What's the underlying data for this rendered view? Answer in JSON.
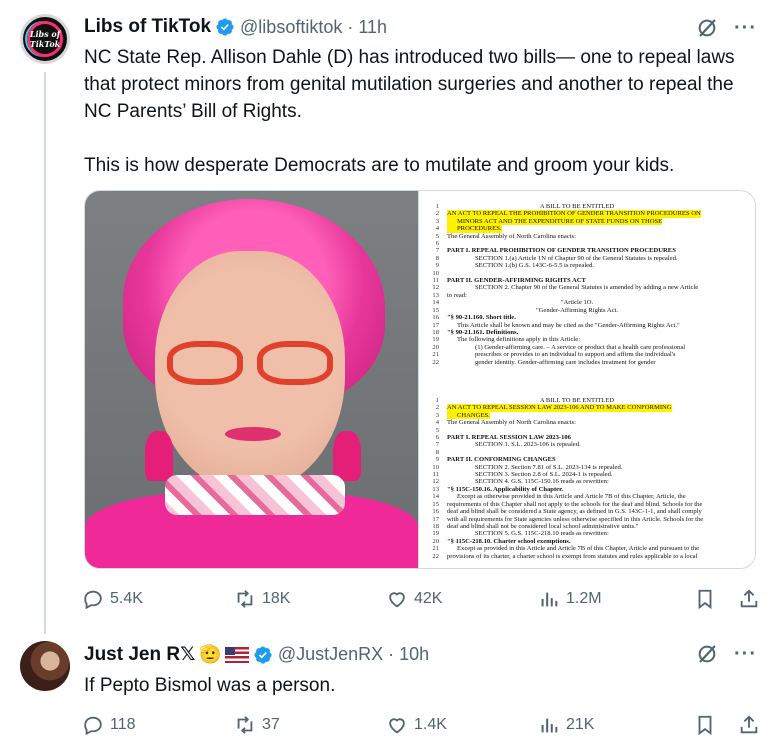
{
  "tweets": [
    {
      "avatar_text": "Libs of TikTok",
      "display_name": "Libs of TikTok",
      "handle": "@libsoftiktok",
      "separator": "·",
      "time": "11h",
      "paragraphs": [
        "NC State Rep. Allison Dahle (D) has introduced two bills— one to repeal laws that protect minors from genital mutilation surgeries and another to repeal the NC Parents’ Bill of Rights.",
        "This is how desperate Democrats are to mutilate and groom your kids."
      ],
      "stats": {
        "replies": "5.4K",
        "reposts": "18K",
        "likes": "42K",
        "views": "1.2M"
      }
    },
    {
      "display_name": "Just Jen R𝕏",
      "handle": "@JustJenRX",
      "separator": "·",
      "time": "10h",
      "emoji": "🫡",
      "text": "If Pepto Bismol was a person.",
      "stats": {
        "replies": "118",
        "reposts": "37",
        "likes": "1.4K",
        "views": "21K"
      }
    }
  ],
  "document": {
    "bill1": [
      {
        "n": "1",
        "t": "A BILL TO BE ENTITLED",
        "style": "center"
      },
      {
        "n": "2",
        "t": "AN ACT TO REPEAL THE PROHIBITION OF GENDER TRANSITION PROCEDURES ON",
        "style": "hl"
      },
      {
        "n": "3",
        "t": "MINORS ACT AND THE EXPENDITURE OF STATE FUNDS ON THOSE",
        "style": "hl indent1"
      },
      {
        "n": "4",
        "t": "PROCEDURES.",
        "style": "hl indent1"
      },
      {
        "n": "5",
        "t": "The General Assembly of North Carolina enacts:",
        "style": ""
      },
      {
        "n": "6",
        "t": "",
        "style": ""
      },
      {
        "n": "7",
        "t": "PART I. REPEAL PROHIBITION OF GENDER TRANSITION PROCEDURES",
        "style": "bold"
      },
      {
        "n": "8",
        "t": "SECTION 1.(a) Article 1N of Chapter 90 of the General Statutes is repealed.",
        "style": "indent2"
      },
      {
        "n": "9",
        "t": "SECTION 1.(b) G.S. 143C-6-5.5 is repealed.",
        "style": "indent2"
      },
      {
        "n": "10",
        "t": "",
        "style": ""
      },
      {
        "n": "11",
        "t": "PART II. GENDER-AFFIRMING RIGHTS ACT",
        "style": "bold"
      },
      {
        "n": "12",
        "t": "SECTION 2. Chapter 90 of the General Statutes is amended by adding a new Article",
        "style": "indent2"
      },
      {
        "n": "13",
        "t": "to read:",
        "style": ""
      },
      {
        "n": "14",
        "t": "\"Article 1O.",
        "style": "center"
      },
      {
        "n": "15",
        "t": "\"Gender-Affirming Rights Act.",
        "style": "center"
      },
      {
        "n": "16",
        "t": "\"§ 90-21.160. Short title.",
        "style": "bold"
      },
      {
        "n": "17",
        "t": "This Article shall be known and may be cited as the \"Gender-Affirming Rights Act.\"",
        "style": "indent1"
      },
      {
        "n": "18",
        "t": "\"§ 90-21.161. Definitions.",
        "style": "bold"
      },
      {
        "n": "19",
        "t": "The following definitions apply in this Article:",
        "style": "indent1"
      },
      {
        "n": "20",
        "t": "(1) Gender-affirming care. – A service or product that a health care professional",
        "style": "indent2"
      },
      {
        "n": "21",
        "t": "prescribes or provides to an individual to support and affirm the individual's",
        "style": "indent2"
      },
      {
        "n": "22",
        "t": "gender identity. Gender-affirming care includes treatment for gender",
        "style": "indent2"
      }
    ],
    "bill2": [
      {
        "n": "1",
        "t": "A BILL TO BE ENTITLED",
        "style": "center"
      },
      {
        "n": "2",
        "t": "AN ACT TO REPEAL SESSION LAW 2023-106 AND TO MAKE CONFORMING",
        "style": "hl"
      },
      {
        "n": "3",
        "t": "CHANGES.",
        "style": "hl indent1"
      },
      {
        "n": "4",
        "t": "The General Assembly of North Carolina enacts:",
        "style": ""
      },
      {
        "n": "5",
        "t": "",
        "style": ""
      },
      {
        "n": "6",
        "t": "PART I. REPEAL SESSION LAW 2023-106",
        "style": "bold"
      },
      {
        "n": "7",
        "t": "SECTION 1. S.L. 2023-106 is repealed.",
        "style": "indent2"
      },
      {
        "n": "8",
        "t": "",
        "style": ""
      },
      {
        "n": "9",
        "t": "PART II. CONFORMING CHANGES",
        "style": "bold"
      },
      {
        "n": "10",
        "t": "SECTION 2. Section 7.81 of S.L. 2023-134 is repealed.",
        "style": "indent2"
      },
      {
        "n": "11",
        "t": "SECTION 3. Section 2.8 of S.L. 2024-1 is repealed.",
        "style": "indent2"
      },
      {
        "n": "12",
        "t": "SECTION 4. G.S. 115C-150.16 reads as rewritten:",
        "style": "indent2"
      },
      {
        "n": "13",
        "t": "\"§ 115C-150.16. Applicability of Chapter.",
        "style": "bold"
      },
      {
        "n": "14",
        "t": "Except as otherwise provided in this Article and Article 7B of this Chapter, Article, the",
        "style": "indent1"
      },
      {
        "n": "15",
        "t": "requirements of this Chapter shall not apply to the schools for the deaf and blind. Schools for the",
        "style": ""
      },
      {
        "n": "16",
        "t": "deaf and blind shall be considered a State agency, as defined in G.S. 143C-1-1, and shall comply",
        "style": ""
      },
      {
        "n": "17",
        "t": "with all requirements for State agencies unless otherwise specified in this Article. Schools for the",
        "style": ""
      },
      {
        "n": "18",
        "t": "deaf and blind shall not be considered local school administrative units.\"",
        "style": ""
      },
      {
        "n": "19",
        "t": "SECTION 5. G.S. 115C-218.10 reads as rewritten:",
        "style": "indent2"
      },
      {
        "n": "20",
        "t": "\"§ 115C-218.10. Charter school exemptions.",
        "style": "bold"
      },
      {
        "n": "21",
        "t": "Except as provided in this Article and Article 7B of this Chapter, Article and pursuant to the",
        "style": "indent1"
      },
      {
        "n": "22",
        "t": "provisions of its charter, a charter school is exempt from statutes and rules applicable to a local",
        "style": ""
      }
    ]
  },
  "icons": [
    "verified-badge-icon",
    "grok-icon",
    "more-icon",
    "reply-icon",
    "repost-icon",
    "like-icon",
    "views-icon",
    "bookmark-icon",
    "share-icon"
  ],
  "colors": {
    "text": "#0f1419",
    "secondary": "#536471",
    "verified": "#1d9bf0",
    "divider": "#cfd9de",
    "highlight": "#fff200"
  }
}
